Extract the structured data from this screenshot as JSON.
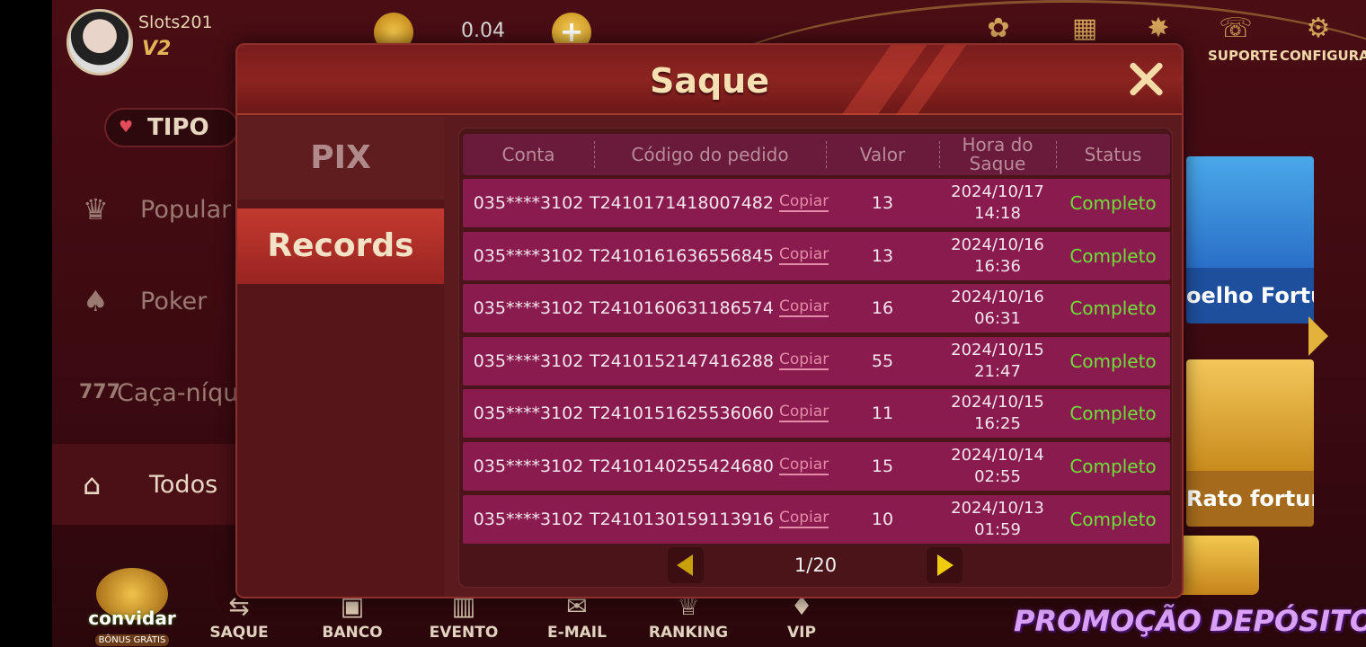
{
  "top": {
    "username": "Slots201",
    "vip_level": "V2",
    "balance": "0.04",
    "suporte_label": "SUPORTE",
    "configura_label": "CONFIGURA"
  },
  "sidebar": {
    "tipo_label": "TIPO",
    "categories": [
      {
        "label": "Popular",
        "icon": "crown-icon"
      },
      {
        "label": "Poker",
        "icon": "cards-icon"
      },
      {
        "label": "Caça-níqu",
        "icon": "slot-777-icon"
      },
      {
        "label": "Todos",
        "icon": "house-bolt-icon",
        "selected": true
      }
    ]
  },
  "games": [
    {
      "name": "oelho Fortuna"
    },
    {
      "name": "Rato fortuna"
    }
  ],
  "bottom_nav": {
    "invite_label": "convidar",
    "invite_badge": "BÔNUS GRÁTIS",
    "items": [
      "SAQUE",
      "BANCO",
      "EVENTO",
      "E-MAIL",
      "RANKING",
      "VIP"
    ],
    "promo_label": "PROMOÇÃO",
    "deposit_label": "DEPÓSITO"
  },
  "modal": {
    "title": "Saque",
    "tabs": {
      "pix": "PIX",
      "records": "Records"
    },
    "columns": {
      "conta": "Conta",
      "codigo": "Código do pedido",
      "valor": "Valor",
      "hora_1": "Hora do",
      "hora_2": "Saque",
      "status": "Status"
    },
    "copy_label": "Copiar",
    "rows": [
      {
        "conta": "035****3102",
        "codigo": "T2410171418007482",
        "valor": "13",
        "date": "2024/10/17",
        "time": "14:18",
        "status": "Completo"
      },
      {
        "conta": "035****3102",
        "codigo": "T2410161636556845",
        "valor": "13",
        "date": "2024/10/16",
        "time": "16:36",
        "status": "Completo"
      },
      {
        "conta": "035****3102",
        "codigo": "T2410160631186574",
        "valor": "16",
        "date": "2024/10/16",
        "time": "06:31",
        "status": "Completo"
      },
      {
        "conta": "035****3102",
        "codigo": "T2410152147416288",
        "valor": "55",
        "date": "2024/10/15",
        "time": "21:47",
        "status": "Completo"
      },
      {
        "conta": "035****3102",
        "codigo": "T2410151625536060",
        "valor": "11",
        "date": "2024/10/15",
        "time": "16:25",
        "status": "Completo"
      },
      {
        "conta": "035****3102",
        "codigo": "T2410140255424680",
        "valor": "15",
        "date": "2024/10/14",
        "time": "02:55",
        "status": "Completo"
      },
      {
        "conta": "035****3102",
        "codigo": "T2410130159113916",
        "valor": "10",
        "date": "2024/10/13",
        "time": "01:59",
        "status": "Completo"
      }
    ],
    "pagination": "1/20"
  },
  "colors": {
    "status_complete": "#6fe03a",
    "row_bg": "#8a1b4e",
    "active_tab": "#c23a2f",
    "title": "#f6dfb2"
  }
}
